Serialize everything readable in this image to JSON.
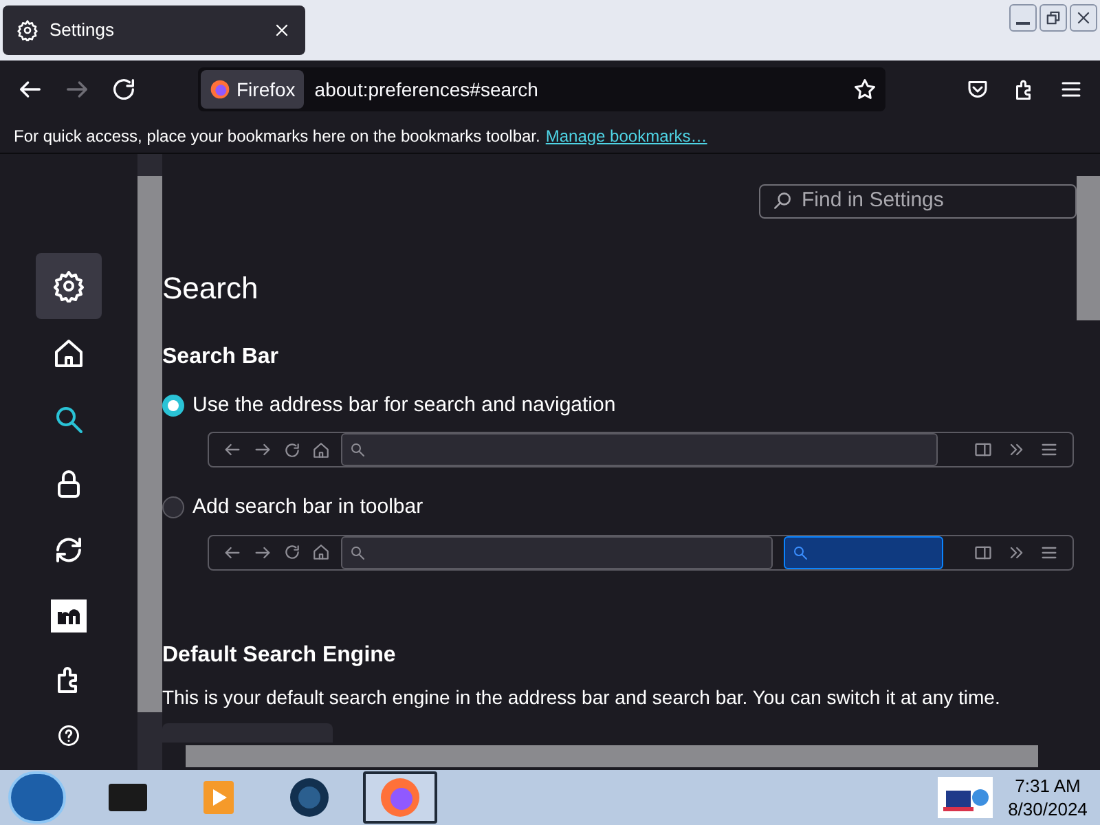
{
  "tab": {
    "title": "Settings",
    "selected": true
  },
  "navbar": {
    "identity": "Firefox",
    "url": "about:preferences#search"
  },
  "bookmarks_bar": {
    "message": "For quick access, place your bookmarks here on the bookmarks toolbar.",
    "link": "Manage bookmarks…"
  },
  "sidebar": {
    "items": [
      {
        "kind": "general",
        "selected": false,
        "hovered": true
      },
      {
        "kind": "home",
        "selected": false,
        "hovered": false
      },
      {
        "kind": "search",
        "selected": true,
        "hovered": false
      },
      {
        "kind": "privacy",
        "selected": false,
        "hovered": false
      },
      {
        "kind": "sync",
        "selected": false,
        "hovered": false
      },
      {
        "kind": "more",
        "selected": false,
        "hovered": false
      },
      {
        "kind": "extensions",
        "selected": false,
        "hovered": false
      },
      {
        "kind": "help",
        "selected": false,
        "hovered": false
      }
    ]
  },
  "find": {
    "placeholder": "Find in Settings"
  },
  "page": {
    "title": "Search",
    "section": "Search Bar",
    "options": [
      {
        "label": "Use the address bar for search and navigation",
        "selected": true,
        "kind": "address_only"
      },
      {
        "label": "Add search bar in toolbar",
        "selected": false,
        "kind": "with_search_bar"
      }
    ],
    "engine_heading": "Default Search Engine",
    "engine_description": "This is your default search engine in the address bar and search bar. You can switch it at any time."
  },
  "taskbar": {
    "apps": [
      {
        "kind": "terminal",
        "selected": false
      },
      {
        "kind": "media",
        "selected": false
      },
      {
        "kind": "globe",
        "selected": false
      },
      {
        "kind": "firefox",
        "selected": true
      }
    ],
    "time": "7:31 AM",
    "date": "8/30/2024"
  }
}
